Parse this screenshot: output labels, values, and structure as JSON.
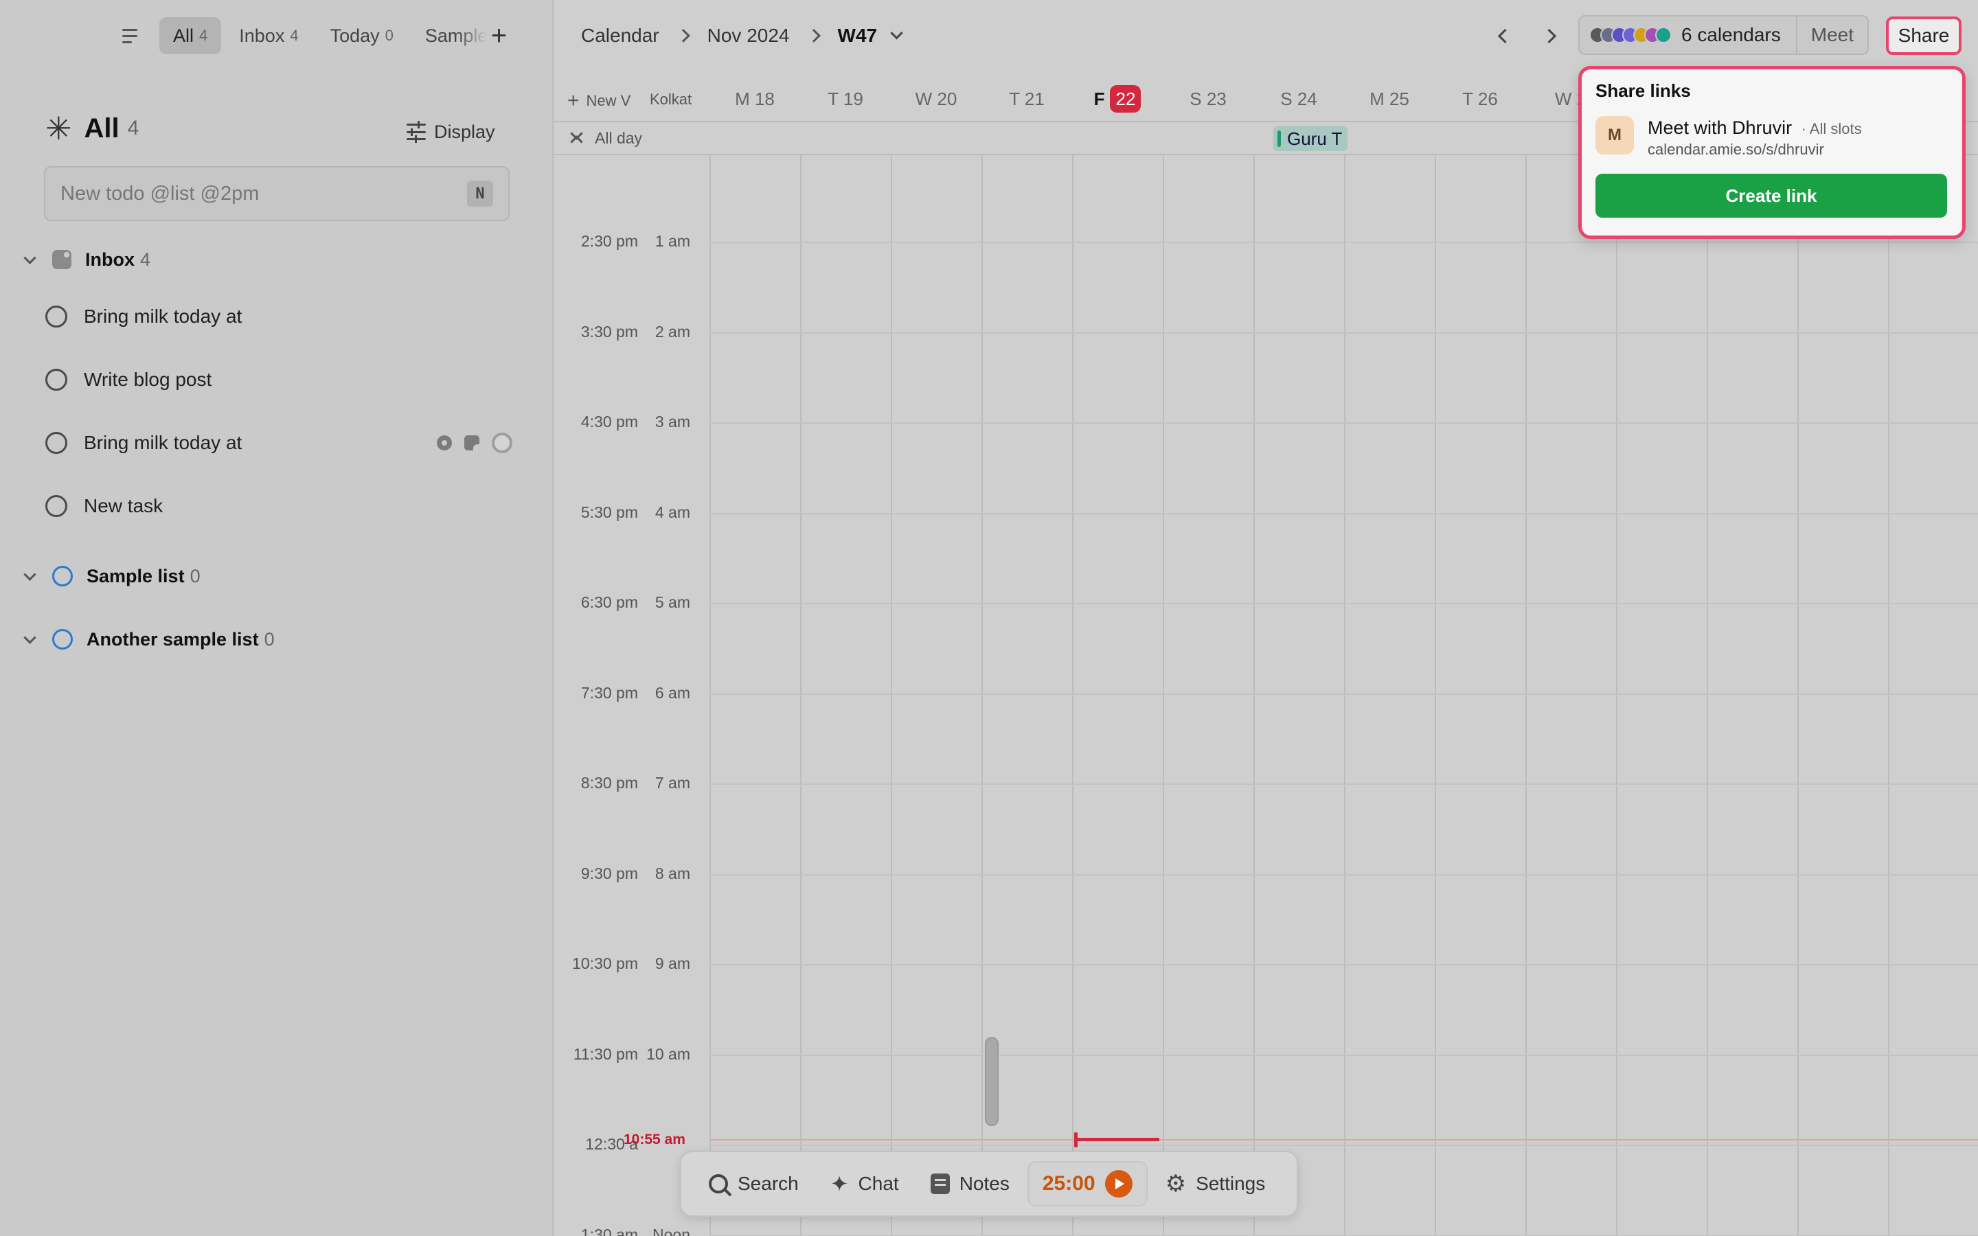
{
  "sidebar": {
    "tabs": [
      {
        "label": "All",
        "count": "4"
      },
      {
        "label": "Inbox",
        "count": "4"
      },
      {
        "label": "Today",
        "count": "0"
      },
      {
        "label": "Sample",
        "count": ""
      }
    ],
    "heading": {
      "title": "All",
      "count": "4"
    },
    "display_label": "Display",
    "todo_input": {
      "placeholder": "New todo @list @2pm",
      "shortcut": "N"
    },
    "inbox": {
      "label": "Inbox",
      "count": "4"
    },
    "tasks": [
      "Bring milk today at",
      "Write blog post",
      "Bring milk today at",
      "New task"
    ],
    "lists": [
      {
        "label": "Sample list",
        "count": "0"
      },
      {
        "label": "Another sample list",
        "count": "0"
      }
    ]
  },
  "header": {
    "breadcrumb": [
      "Calendar",
      "Nov 2024",
      "W47"
    ],
    "calendars_label": "6 calendars",
    "calendar_colors": [
      "#5a5a5a",
      "#6b6b8a",
      "#5a4fc4",
      "#6b62d6",
      "#d4a017",
      "#a64fb8",
      "#17a08a"
    ],
    "meet_label": "Meet",
    "share_label": "Share"
  },
  "calendar": {
    "new_view_label": "New V",
    "timezone_label": "Kolkat",
    "allday_label": "All day",
    "allday_event": "Guru T",
    "days": [
      {
        "label": "M 18"
      },
      {
        "label": "T 19"
      },
      {
        "label": "W 20"
      },
      {
        "label": "T 21"
      },
      {
        "label": "F",
        "badge": "22",
        "today": true
      },
      {
        "label": "S 23"
      },
      {
        "label": "S 24"
      },
      {
        "label": "M 25"
      },
      {
        "label": "T 26"
      },
      {
        "label": "W 2"
      }
    ],
    "times": [
      {
        "a": "2:30 pm",
        "b": "1 am"
      },
      {
        "a": "3:30 pm",
        "b": "2 am"
      },
      {
        "a": "4:30 pm",
        "b": "3 am"
      },
      {
        "a": "5:30 pm",
        "b": "4 am"
      },
      {
        "a": "6:30 pm",
        "b": "5 am"
      },
      {
        "a": "7:30 pm",
        "b": "6 am"
      },
      {
        "a": "8:30 pm",
        "b": "7 am"
      },
      {
        "a": "9:30 pm",
        "b": "8 am"
      },
      {
        "a": "10:30 pm",
        "b": "9 am"
      },
      {
        "a": "11:30 pm",
        "b": "10 am"
      },
      {
        "a": "12:30 a",
        "b": ""
      },
      {
        "a": "1:30 am",
        "b": "Noon"
      }
    ],
    "now_label": "10:55 am"
  },
  "share_popover": {
    "title": "Share links",
    "avatar": "M",
    "link_name": "Meet with Dhruvir",
    "link_slots": "· All slots",
    "link_url": "calendar.amie.so/s/dhruvir",
    "create_label": "Create link"
  },
  "toolbar": {
    "search": "Search",
    "chat": "Chat",
    "notes": "Notes",
    "timer": "25:00",
    "settings": "Settings"
  }
}
